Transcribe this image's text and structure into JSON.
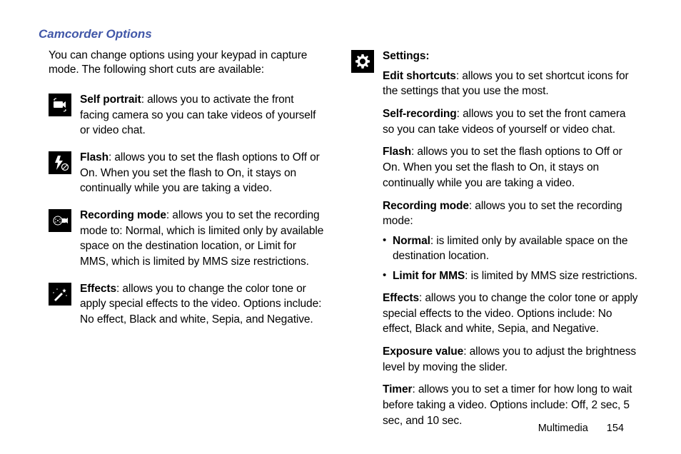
{
  "title": "Camcorder Options",
  "intro": "You can change options using your keypad in capture mode. The following short cuts are available:",
  "left_items": [
    {
      "label": "Self portrait",
      "text": ": allows you to activate the front facing camera so you can take videos of yourself or video chat."
    },
    {
      "label": "Flash",
      "text": ": allows you to set the flash options to Off or On. When you set the flash to On, it stays on continually while you are taking a video."
    },
    {
      "label": "Recording mode",
      "text": ": allows you to set the recording mode to: Normal, which is limited only by available space on the destination location, or Limit for MMS, which is limited by MMS size restrictions."
    },
    {
      "label": "Effects",
      "text": ": allows you to change the color tone or apply special effects to the video. Options include: No effect, Black and white, Sepia, and Negative."
    }
  ],
  "settings": {
    "heading": "Settings:",
    "edit_label": "Edit shortcuts",
    "edit_text": ": allows you to set shortcut icons for the settings that you use the most.",
    "selfrec_label": "Self-recording",
    "selfrec_text": ": allows you to set the front camera so you can take videos of yourself or video chat.",
    "flash_label": "Flash",
    "flash_text": ": allows you to set the flash options to Off or On. When you set the flash to On, it stays on continually while you are taking a video.",
    "recmode_label": "Recording mode",
    "recmode_text": ": allows you to set the recording mode:",
    "normal_label": "Normal",
    "normal_text": ": is limited only by available space on the destination location.",
    "mms_label": "Limit for MMS",
    "mms_text": ": is limited by MMS size restrictions.",
    "effects_label": "Effects",
    "effects_text": ": allows you to change the color tone or apply special effects to the video. Options include: No effect, Black and white, Sepia, and Negative.",
    "exposure_label": "Exposure value",
    "exposure_text": ": allows you to adjust the brightness level by moving the slider.",
    "timer_label": "Timer",
    "timer_text": ": allows you to set a timer for how long to wait before taking a video. Options include: Off, 2 sec, 5 sec, and 10 sec."
  },
  "footer": {
    "section": "Multimedia",
    "page": "154"
  }
}
